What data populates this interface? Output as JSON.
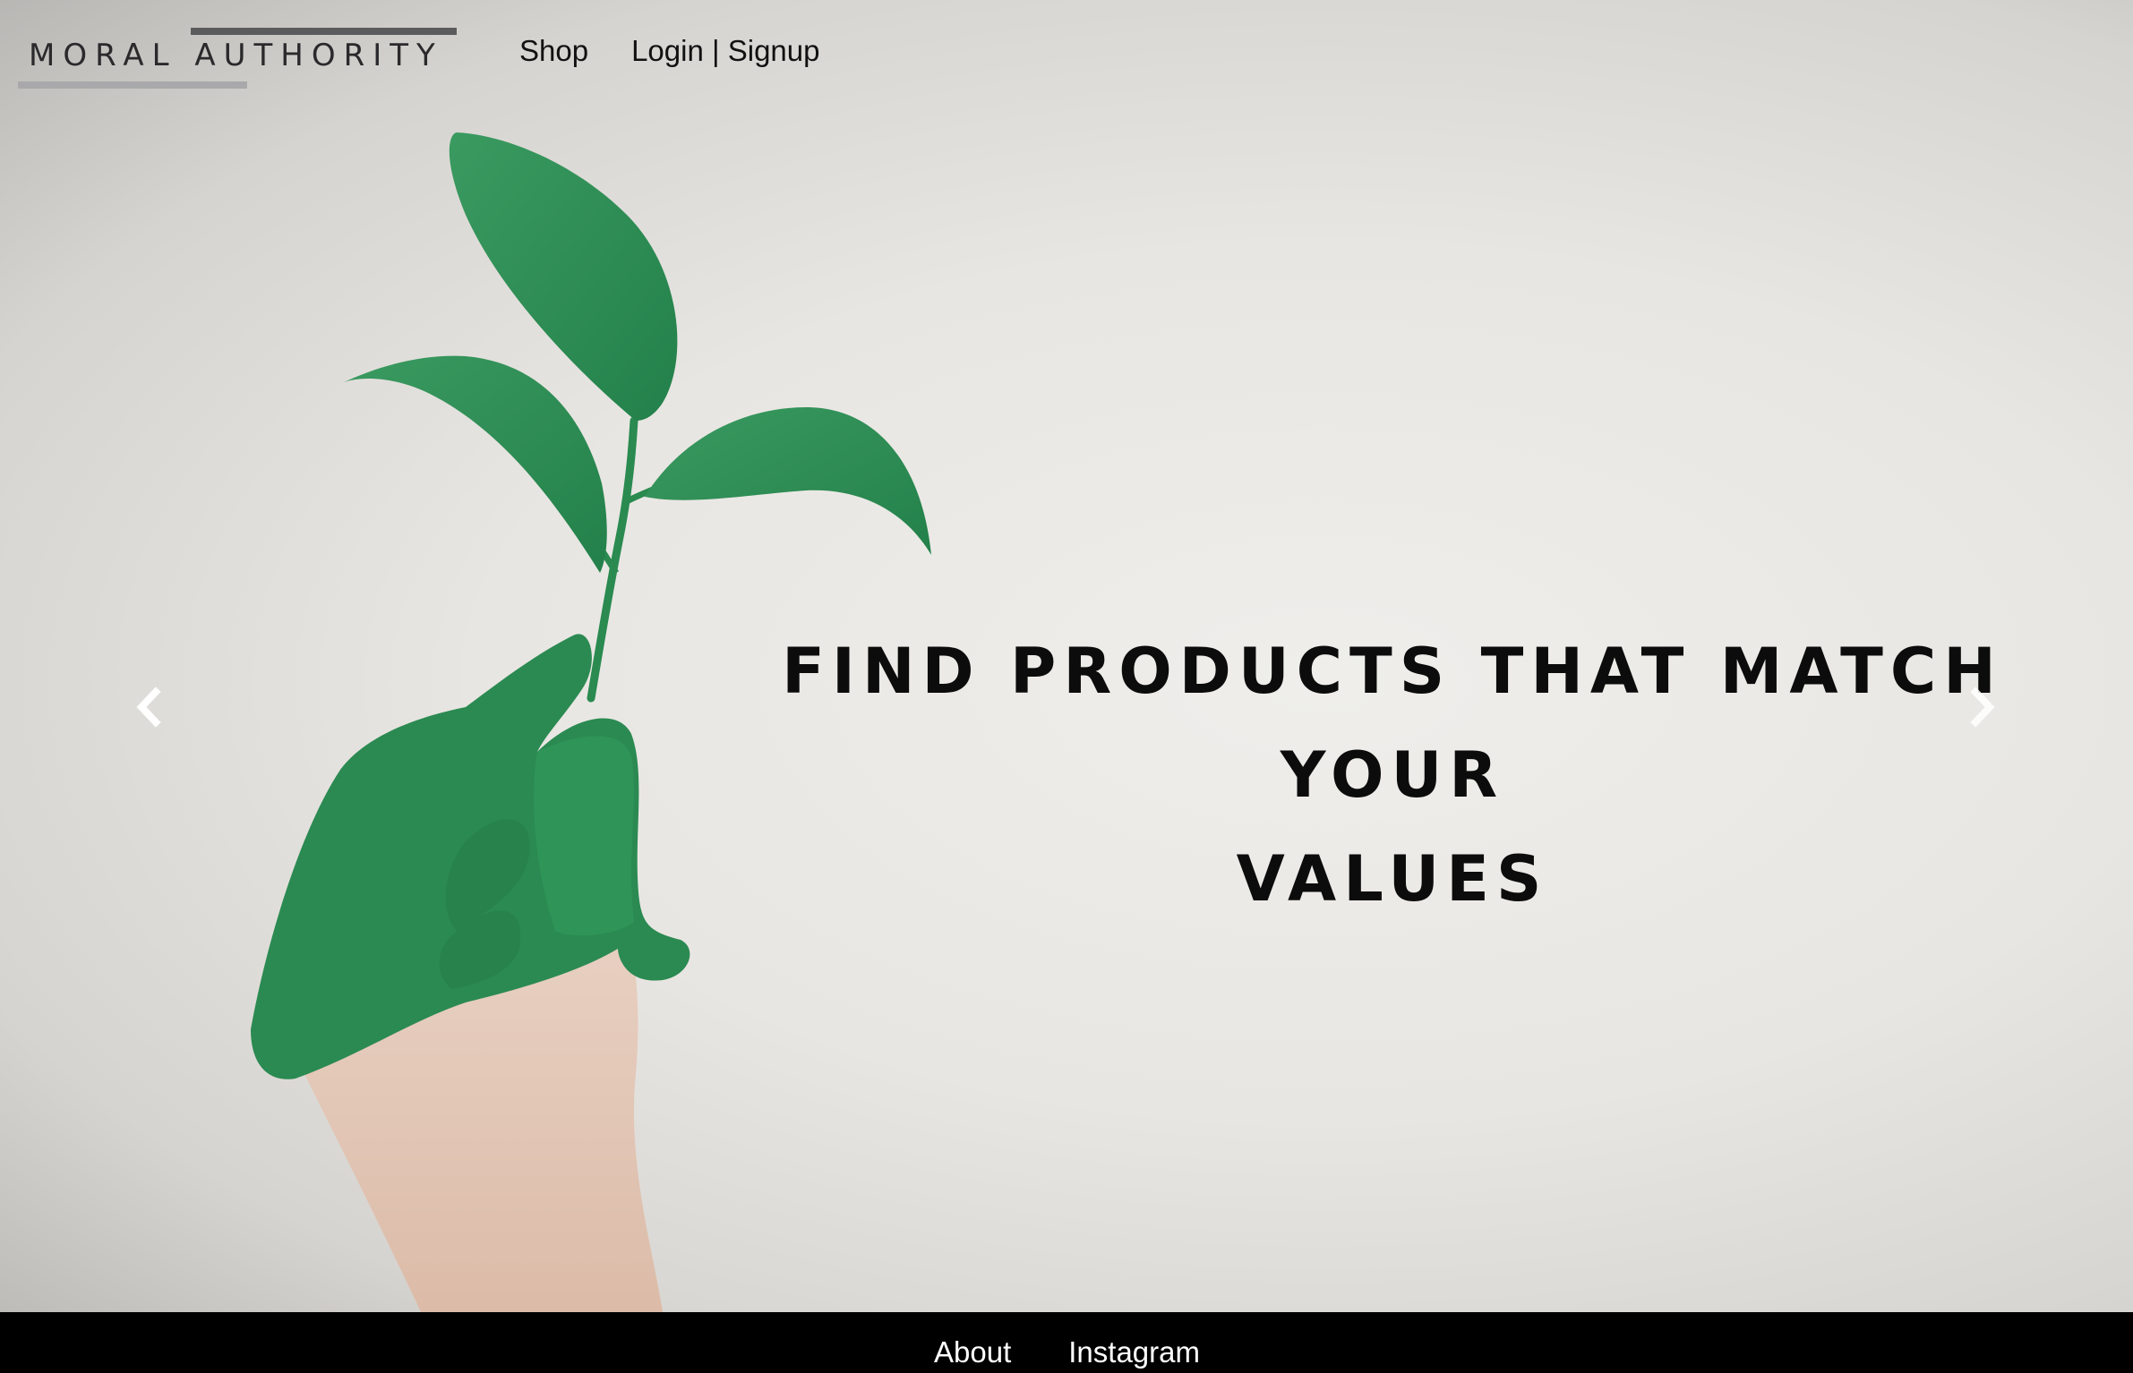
{
  "header": {
    "logo_text": "MORAL AUTHORITY",
    "nav": [
      {
        "label": "Shop"
      },
      {
        "label": "Login | Signup"
      }
    ]
  },
  "hero": {
    "headline_line1": "FIND PRODUCTS THAT MATCH YOUR",
    "headline_line2": "VALUES",
    "prev_icon": "chevron-left-icon",
    "next_icon": "chevron-right-icon"
  },
  "footer": {
    "links": [
      {
        "label": "About"
      },
      {
        "label": "Instagram"
      }
    ]
  },
  "colors": {
    "leaf_green": "#2f8f55",
    "background": "#e8e6e2",
    "footer_bg": "#000000",
    "text_dark": "#0c0c0c"
  }
}
